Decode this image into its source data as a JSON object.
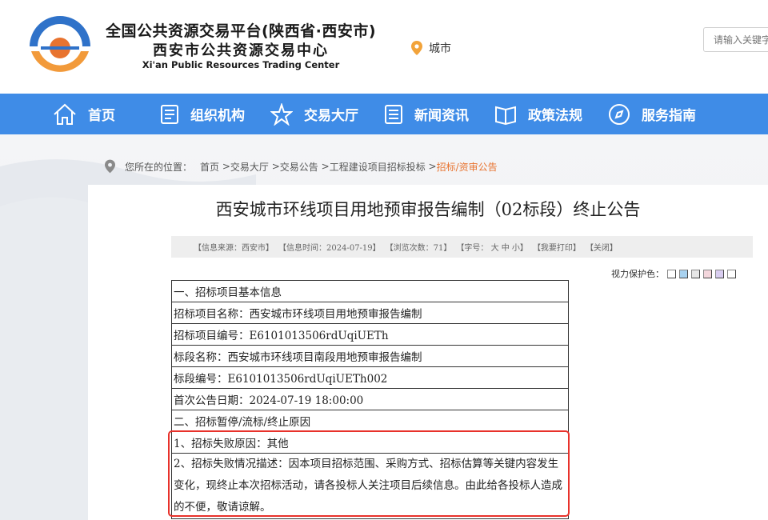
{
  "header": {
    "title": "全国公共资源交易平台(陕西省·西安市)",
    "subtitle": "西安市公共资源交易中心",
    "title_en": "Xi'an Public Resources Trading Center",
    "city_label": "城市",
    "search_placeholder": "请输入关键字"
  },
  "nav": {
    "items": [
      {
        "label": "首页",
        "icon": "home-icon"
      },
      {
        "label": "组织机构",
        "icon": "document-icon"
      },
      {
        "label": "交易大厅",
        "icon": "star-icon"
      },
      {
        "label": "新闻资讯",
        "icon": "news-icon"
      },
      {
        "label": "政策法规",
        "icon": "book-icon"
      },
      {
        "label": "服务指南",
        "icon": "compass-icon"
      }
    ]
  },
  "breadcrumb": {
    "prefix": "您所在的位置：",
    "items": [
      "首页",
      "交易大厅",
      "交易公告",
      "工程建设项目招标投标"
    ],
    "active": "招标/资审公告"
  },
  "article": {
    "title": "西安城市环线项目用地预审报告编制（02标段）终止公告",
    "meta": {
      "source": "【信息来源：西安市】",
      "time": "【信息时间：2024-07-19】",
      "views": "【浏览次数：71】",
      "font_size": "【字号： 大 中 小】",
      "print": "【我要打印】",
      "close": "【关闭】"
    },
    "eye_care_label": "视力保护色：",
    "eye_care_colors": [
      "#ffffff",
      "#a8d2f0",
      "#e6e6e6",
      "#f3d6dc",
      "#d9cdf0",
      "#ffffff"
    ],
    "rows": [
      "一、招标项目基本信息",
      "招标项目名称：西安城市环线项目用地预审报告编制",
      "招标项目编号：E6101013506rdUqiUETh",
      "标段名称：西安城市环线项目南段用地预审报告编制",
      "标段编号：E6101013506rdUqiUETh002",
      "首次公告日期：2024-07-19 18:00:00",
      "二、招标暂停/流标/终止原因",
      "1、招标失败原因：其他",
      "2、招标失败情况描述：因本项目招标范围、采购方式、招标估算等关键内容发生变化，现终止本次招标活动，请各投标人关注项目后续信息。由此给各投标人造成的不便，敬请谅解。"
    ]
  },
  "colors": {
    "nav_bg": "#3f8ce7",
    "accent_orange": "#e8732f",
    "logo_blue": "#2f72c9",
    "highlight_red": "#e8322b"
  }
}
